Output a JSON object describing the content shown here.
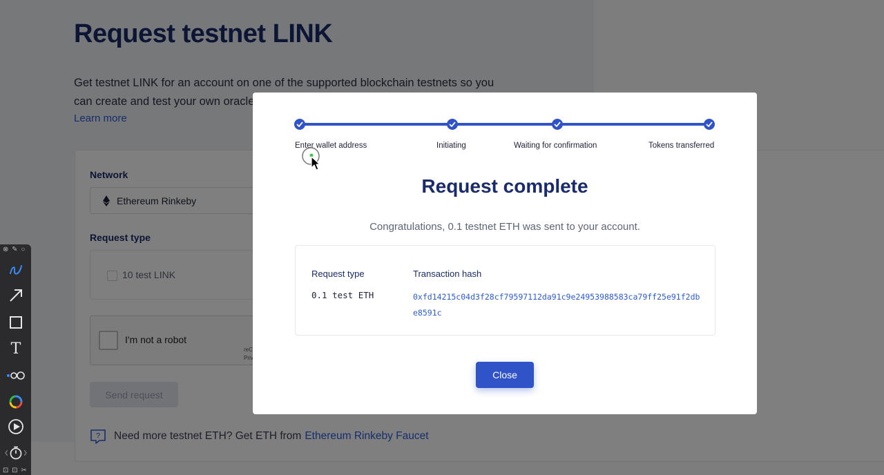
{
  "page": {
    "title": "Request testnet LINK",
    "description": "Get testnet LINK for an account on one of the supported blockchain testnets so you can create and test your own oracle and Chainlinked smart contract.",
    "learn_more": "Learn more"
  },
  "form": {
    "network_label": "Network",
    "network_value": "Ethereum Rinkeby",
    "request_type_label": "Request type",
    "request_type_option": "10 test LINK",
    "captcha_label": "I'm not a robot",
    "captcha_brand": "reCAPTCHA",
    "captcha_sub": "Privacy - Terms",
    "send_button": "Send request",
    "help_text": "Need more testnet ETH? Get ETH from",
    "help_link": "Ethereum Rinkeby Faucet"
  },
  "modal": {
    "steps": [
      {
        "label": "Enter wallet address"
      },
      {
        "label": "Initiating"
      },
      {
        "label": "Waiting for confirmation"
      },
      {
        "label": "Tokens transferred"
      }
    ],
    "title": "Request complete",
    "message": "Congratulations, 0.1 testnet ETH was sent to your account.",
    "col_request_type": "Request type",
    "col_tx_hash": "Transaction hash",
    "request_type_value": "0.1 test ETH",
    "tx_hash_value": "0xfd14215c04d3f28cf79597112da91c9e24953988583ca79ff25e91f2dbe8591c",
    "close_button": "Close"
  },
  "toolbar": {
    "tools": [
      "pen-icon",
      "arrow-icon",
      "rectangle-icon",
      "text-icon",
      "stroke-width-icon",
      "color-wheel-icon",
      "play-icon",
      "timer-icon"
    ]
  },
  "colors": {
    "accent": "#3053c7",
    "link": "#2a5bd7",
    "heading": "#1a2b6b"
  }
}
